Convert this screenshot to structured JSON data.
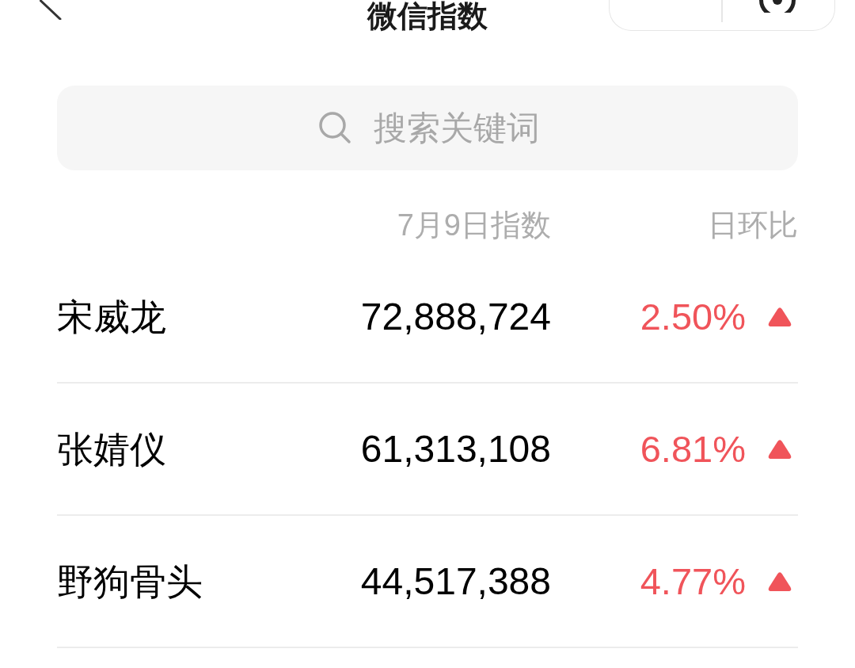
{
  "header": {
    "title": "微信指数"
  },
  "search": {
    "placeholder": "搜索关键词"
  },
  "columns": [
    {
      "label": "7月9日指数"
    },
    {
      "label": "日环比"
    }
  ],
  "rows": [
    {
      "name": "宋威龙",
      "index": "72,888,724",
      "change": "2.50%",
      "up": true
    },
    {
      "name": "张婧仪",
      "index": "61,313,108",
      "change": "6.81%",
      "up": true
    },
    {
      "name": "野狗骨头",
      "index": "44,517,388",
      "change": "4.77%",
      "up": true
    }
  ]
}
